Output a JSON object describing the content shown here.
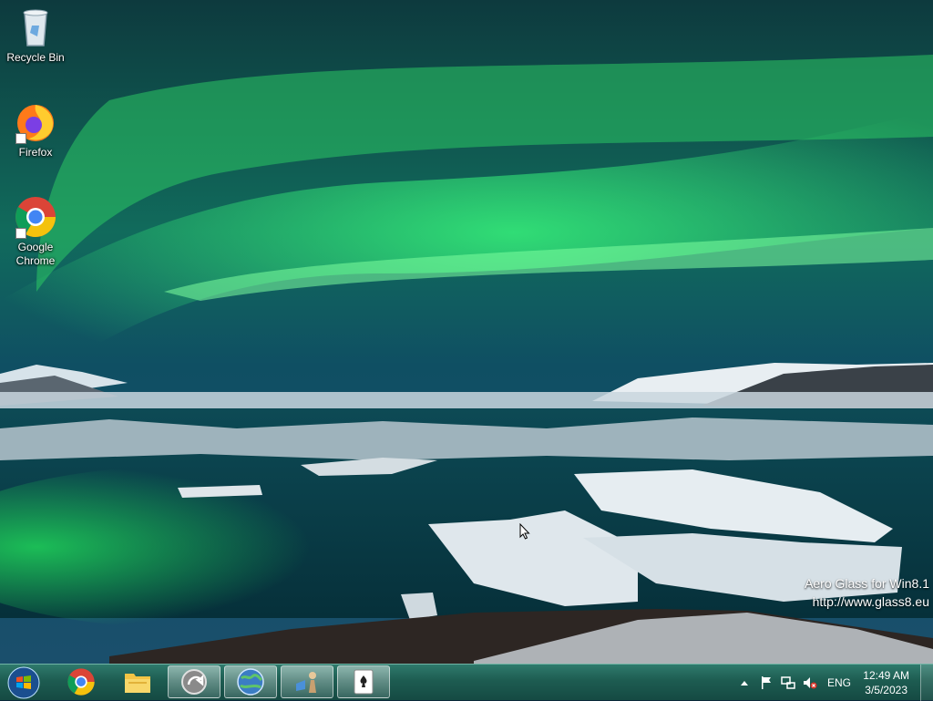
{
  "desktop": {
    "icons": [
      {
        "label": "Recycle Bin",
        "icon": "recycle-bin-icon"
      },
      {
        "label": "Firefox",
        "icon": "firefox-icon"
      },
      {
        "label": "Google Chrome",
        "icon": "chrome-icon"
      }
    ],
    "watermark": {
      "line1": "Aero Glass for Win8.1",
      "line2": "http://www.glass8.eu"
    }
  },
  "taskbar": {
    "pinned": [
      {
        "icon": "chrome-icon"
      },
      {
        "icon": "file-explorer-icon"
      },
      {
        "icon": "app-arrow-icon"
      },
      {
        "icon": "globe-app-icon"
      },
      {
        "icon": "chess-app-icon"
      },
      {
        "icon": "solitaire-icon"
      }
    ],
    "tray": {
      "language": "ENG",
      "time": "12:49 AM",
      "date": "3/5/2023"
    }
  },
  "colors": {
    "aurora": "#2fe36a",
    "taskbar": "#1d5c51"
  }
}
